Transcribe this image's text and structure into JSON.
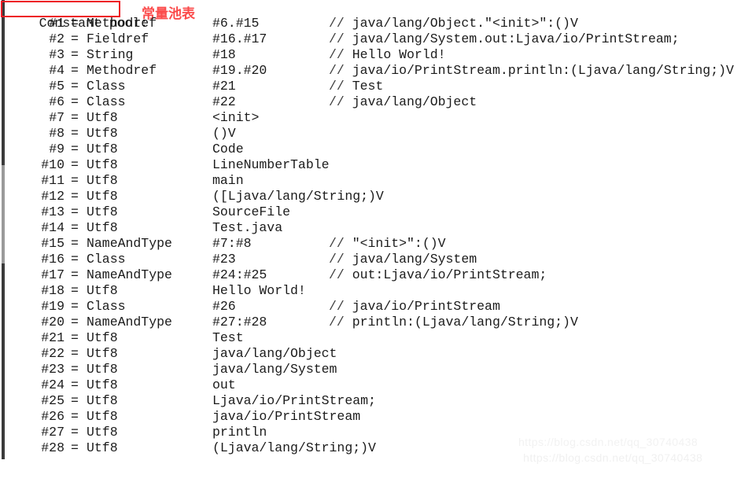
{
  "heading": {
    "text": "Constant pool:",
    "box_color": "#ee1c25"
  },
  "annotation": {
    "text": "常量池表",
    "color": "#fb4b4b"
  },
  "watermark": {
    "text": "https://blog.csdn.net/qq_30740438",
    "text_shadow": "https://blog.csdn.net/qq_30740438"
  },
  "constant_pool": {
    "separator": "=",
    "comment_prefix": "//",
    "entries": [
      {
        "index": "#1",
        "tag": "Methodref",
        "value": "#6.#15",
        "comment": "java/lang/Object.\"<init>\":()V"
      },
      {
        "index": "#2",
        "tag": "Fieldref",
        "value": "#16.#17",
        "comment": "java/lang/System.out:Ljava/io/PrintStream;"
      },
      {
        "index": "#3",
        "tag": "String",
        "value": "#18",
        "comment": "Hello World!"
      },
      {
        "index": "#4",
        "tag": "Methodref",
        "value": "#19.#20",
        "comment": "java/io/PrintStream.println:(Ljava/lang/String;)V"
      },
      {
        "index": "#5",
        "tag": "Class",
        "value": "#21",
        "comment": "Test"
      },
      {
        "index": "#6",
        "tag": "Class",
        "value": "#22",
        "comment": "java/lang/Object"
      },
      {
        "index": "#7",
        "tag": "Utf8",
        "value": "<init>",
        "comment": ""
      },
      {
        "index": "#8",
        "tag": "Utf8",
        "value": "()V",
        "comment": ""
      },
      {
        "index": "#9",
        "tag": "Utf8",
        "value": "Code",
        "comment": ""
      },
      {
        "index": "#10",
        "tag": "Utf8",
        "value": "LineNumberTable",
        "comment": ""
      },
      {
        "index": "#11",
        "tag": "Utf8",
        "value": "main",
        "comment": ""
      },
      {
        "index": "#12",
        "tag": "Utf8",
        "value": "([Ljava/lang/String;)V",
        "comment": ""
      },
      {
        "index": "#13",
        "tag": "Utf8",
        "value": "SourceFile",
        "comment": ""
      },
      {
        "index": "#14",
        "tag": "Utf8",
        "value": "Test.java",
        "comment": ""
      },
      {
        "index": "#15",
        "tag": "NameAndType",
        "value": "#7:#8",
        "comment": "\"<init>\":()V"
      },
      {
        "index": "#16",
        "tag": "Class",
        "value": "#23",
        "comment": "java/lang/System"
      },
      {
        "index": "#17",
        "tag": "NameAndType",
        "value": "#24:#25",
        "comment": "out:Ljava/io/PrintStream;"
      },
      {
        "index": "#18",
        "tag": "Utf8",
        "value": "Hello World!",
        "comment": ""
      },
      {
        "index": "#19",
        "tag": "Class",
        "value": "#26",
        "comment": "java/io/PrintStream"
      },
      {
        "index": "#20",
        "tag": "NameAndType",
        "value": "#27:#28",
        "comment": "println:(Ljava/lang/String;)V"
      },
      {
        "index": "#21",
        "tag": "Utf8",
        "value": "Test",
        "comment": ""
      },
      {
        "index": "#22",
        "tag": "Utf8",
        "value": "java/lang/Object",
        "comment": ""
      },
      {
        "index": "#23",
        "tag": "Utf8",
        "value": "java/lang/System",
        "comment": ""
      },
      {
        "index": "#24",
        "tag": "Utf8",
        "value": "out",
        "comment": ""
      },
      {
        "index": "#25",
        "tag": "Utf8",
        "value": "Ljava/io/PrintStream;",
        "comment": ""
      },
      {
        "index": "#26",
        "tag": "Utf8",
        "value": "java/io/PrintStream",
        "comment": ""
      },
      {
        "index": "#27",
        "tag": "Utf8",
        "value": "println",
        "comment": ""
      },
      {
        "index": "#28",
        "tag": "Utf8",
        "value": "(Ljava/lang/String;)V",
        "comment": ""
      }
    ]
  }
}
